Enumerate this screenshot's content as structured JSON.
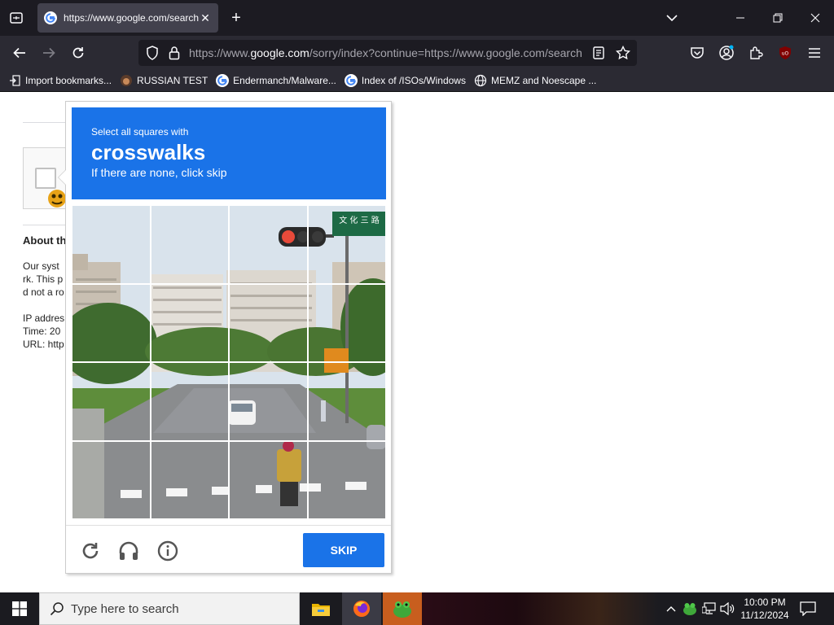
{
  "browser": {
    "tab": {
      "title": "https://www.google.com/search",
      "close": "✕"
    },
    "new_tab": "+",
    "url": {
      "domain_prefix": "https://www.",
      "domain": "google.com",
      "rest": "/sorry/index?continue=https://www.google.com/search"
    },
    "bookmarks": [
      {
        "label": "Import bookmarks..."
      },
      {
        "label": "RUSSIAN TEST"
      },
      {
        "label": "Endermanch/Malware..."
      },
      {
        "label": "Index of /ISOs/Windows"
      },
      {
        "label": "MEMZ and Noescape ..."
      }
    ],
    "colors": {
      "tabbar": "#1c1b22",
      "toolbar": "#2b2a33",
      "accent": "#1a73e8"
    }
  },
  "page": {
    "about_heading": "About th",
    "lines": [
      "Our syst",
      "rk. This p",
      "d not a ro",
      "IP addres",
      "Time: 20",
      "URL: http"
    ]
  },
  "captcha": {
    "instruction": "Select all squares with",
    "target": "crosswalks",
    "hint": "If there are none, click skip",
    "skip_label": "SKIP",
    "sign_text": "文 化 三 路",
    "grid_size": 4
  },
  "taskbar": {
    "search_placeholder": "Type here to search",
    "time": "10:00 PM",
    "date": "11/12/2024"
  }
}
